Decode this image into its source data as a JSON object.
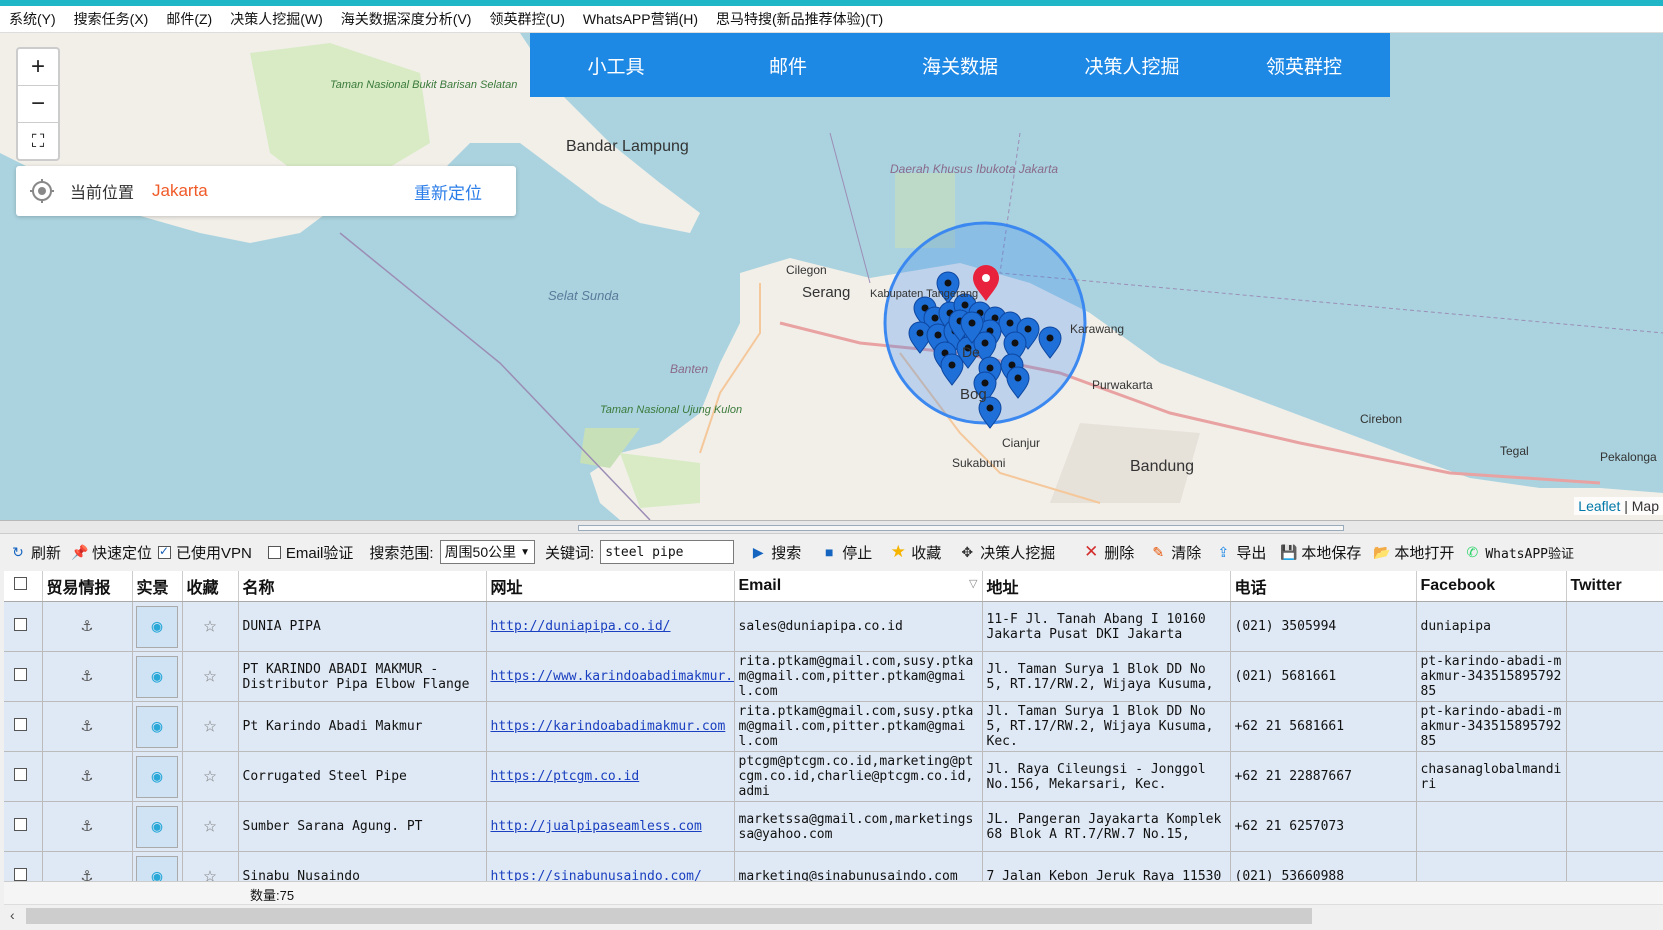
{
  "menu": [
    "系统(Y)",
    "搜索任务(X)",
    "邮件(Z)",
    "决策人挖掘(W)",
    "海关数据深度分析(V)",
    "领英群控(U)",
    "WhatsAPP营销(H)",
    "思马特搜(新品推荐体验)(T)"
  ],
  "map": {
    "zoom_in": "+",
    "zoom_out": "−",
    "fullscreen": "⛶",
    "location_label": "当前位置",
    "location_city": "Jakarta",
    "relocate": "重新定位",
    "tabs": [
      "小工具",
      "邮件",
      "海关数据",
      "决策人挖掘",
      "领英群控"
    ],
    "attribution_link": "Leaflet",
    "attribution_rest": " | Map",
    "places": {
      "bandar_lampung": "Bandar Lampung",
      "taman_bukit": "Taman Nasional Bukit Barisan Selatan",
      "daerah_khusus": "Daerah Khusus Ibukota Jakarta",
      "cilegon": "Cilegon",
      "serang": "Serang",
      "kabupaten": "Kabupaten Tangerang",
      "selat_sunda": "Selat Sunda",
      "banten": "Banten",
      "taman_ujung": "Taman Nasional Ujung Kulon",
      "karawang": "Karawang",
      "purwakarta": "Purwakarta",
      "cirebon": "Cirebon",
      "cianjur": "Cianjur",
      "sukabumi": "Sukabumi",
      "bandung": "Bandung",
      "tegal": "Tegal",
      "pekalongan": "Pekalonga",
      "bogor": "Bog",
      "depok": "De"
    }
  },
  "toolbar": {
    "refresh": "刷新",
    "quick_locate": "快速定位",
    "vpn": "已使用VPN",
    "email_verify": "Email验证",
    "range_label": "搜索范围:",
    "range_value": "周围50公里",
    "keyword_label": "关键词:",
    "keyword_value": "steel pipe",
    "search": "搜索",
    "stop": "停止",
    "favorite": "收藏",
    "decision": "决策人挖掘",
    "delete": "删除",
    "clear": "清除",
    "export": "导出",
    "save_local": "本地保存",
    "open_local": "本地打开",
    "whatsapp": "WhatsAPP验证"
  },
  "table": {
    "headers": [
      "",
      "贸易情报",
      "实景",
      "收藏",
      "名称",
      "网址",
      "Email",
      "地址",
      "电话",
      "Facebook",
      "Twitter"
    ],
    "rows": [
      {
        "name": "DUNIA PIPA",
        "url": "http://duniapipa.co.id/",
        "email": "sales@duniapipa.co.id",
        "address": "11-F Jl. Tanah Abang I 10160 Jakarta Pusat DKI Jakarta",
        "phone": "(021) 3505994",
        "facebook": "duniapipa",
        "twitter": ""
      },
      {
        "name": "PT KARINDO ABADI MAKMUR - Distributor Pipa Elbow Flange",
        "url": "https://www.karindoabadimakmur.com/",
        "email": "rita.ptkam@gmail.com,susy.ptkam@gmail.com,pitter.ptkam@gmail.com",
        "address": "Jl. Taman Surya 1 Blok DD No 5, RT.17/RW.2, Wijaya Kusuma,",
        "phone": "(021) 5681661",
        "facebook": "pt-karindo-abadi-makmur-34351589579285",
        "twitter": ""
      },
      {
        "name": "Pt Karindo Abadi Makmur",
        "url": "https://karindoabadimakmur.com",
        "email": "rita.ptkam@gmail.com,susy.ptkam@gmail.com,pitter.ptkam@gmail.com",
        "address": "Jl. Taman Surya 1 Blok DD No 5, RT.17/RW.2, Wijaya Kusuma, Kec.",
        "phone": "+62 21 5681661",
        "facebook": "pt-karindo-abadi-makmur-34351589579285",
        "twitter": ""
      },
      {
        "name": "Corrugated Steel Pipe",
        "url": "https://ptcgm.co.id",
        "email": "ptcgm@ptcgm.co.id,marketing@ptcgm.co.id,charlie@ptcgm.co.id,admi",
        "address": "Jl. Raya Cileungsi - Jonggol No.156, Mekarsari, Kec.",
        "phone": "+62 21 22887667",
        "facebook": "chasanaglobalmandiri",
        "twitter": ""
      },
      {
        "name": "Sumber Sarana Agung. PT",
        "url": "http://jualpipaseamless.com",
        "email": "marketssa@gmail.com,marketingssa@yahoo.com",
        "address": "JL. Pangeran Jayakarta Komplek 68 Blok A RT.7/RW.7 No.15,",
        "phone": "+62 21 6257073",
        "facebook": "",
        "twitter": ""
      },
      {
        "name": "Sinabu Nusaindo",
        "url": "https://sinabunusaindo.com/",
        "email": "marketing@sinabunusaindo.com",
        "address": "7 Jalan Kebon Jeruk Raya 11530",
        "phone": "(021) 53660988",
        "facebook": "",
        "twitter": ""
      }
    ]
  },
  "status": {
    "count": "数量:75"
  },
  "colors": {
    "accent": "#1fb7c7",
    "tab_bar": "#1e88e5",
    "marker": "#1e6fd8",
    "center_marker": "#e8223c",
    "location_city": "#f05a28",
    "link": "#2b7de9"
  }
}
